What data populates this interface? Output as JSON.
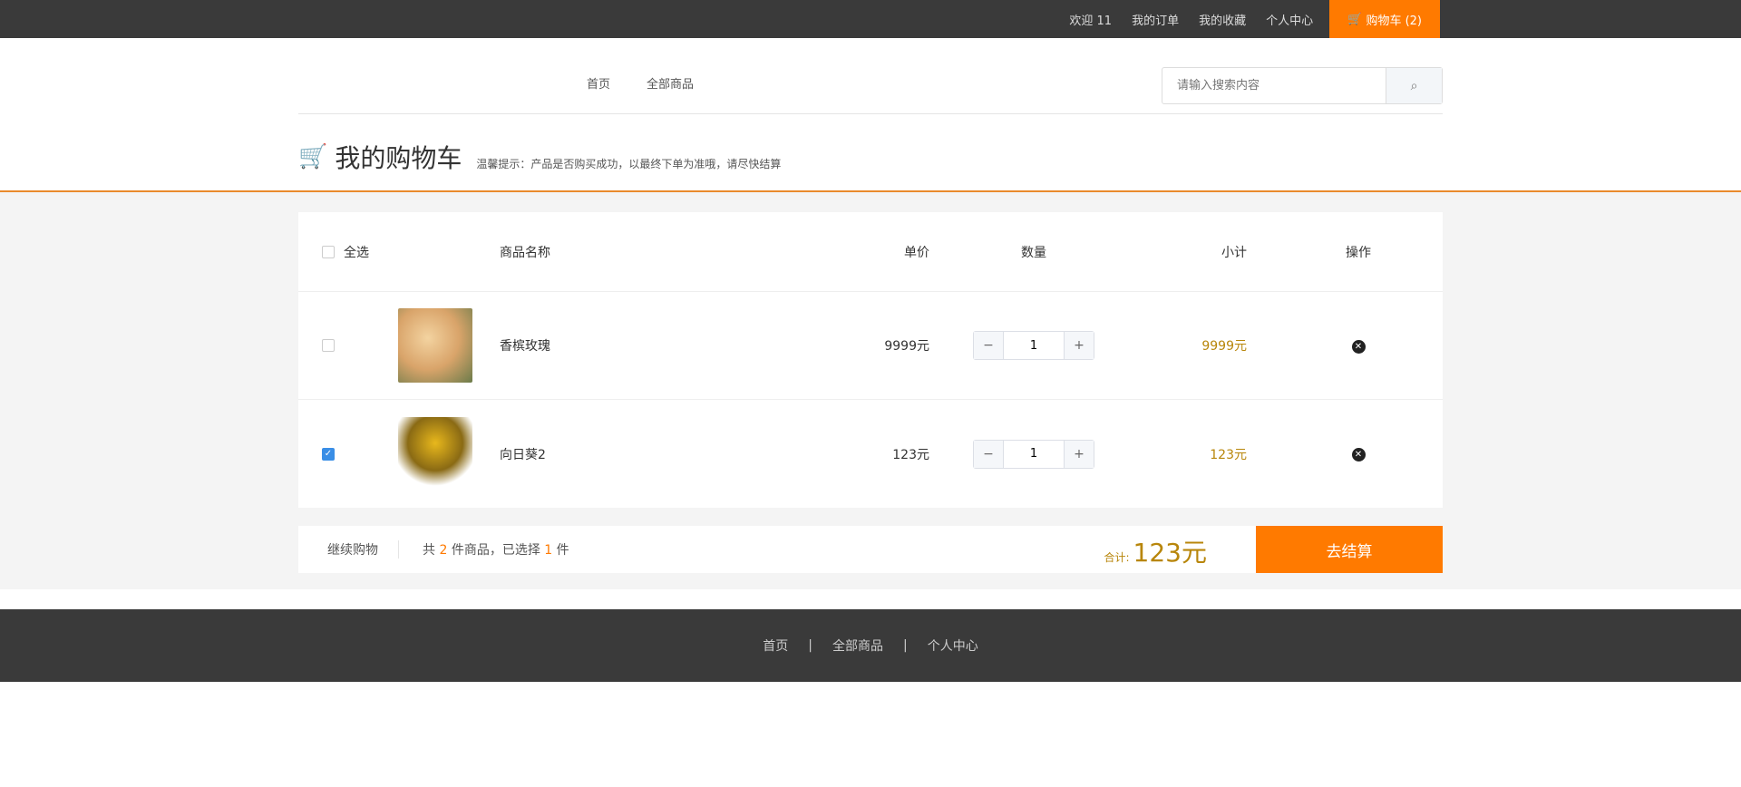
{
  "topbar": {
    "welcome": "欢迎 11",
    "orders": "我的订单",
    "favorites": "我的收藏",
    "profile": "个人中心",
    "cart": "购物车 (2)"
  },
  "nav": {
    "home": "首页",
    "all": "全部商品"
  },
  "search": {
    "placeholder": "请输入搜索内容"
  },
  "page": {
    "title": "我的购物车",
    "tip": "温馨提示：产品是否购买成功，以最终下单为准哦，请尽快结算"
  },
  "table": {
    "headers": {
      "select_all": "全选",
      "name": "商品名称",
      "price": "单价",
      "qty": "数量",
      "subtotal": "小计",
      "action": "操作"
    },
    "items": [
      {
        "name": "香槟玫瑰",
        "price": "9999元",
        "qty": "1",
        "subtotal": "9999元",
        "checked": false
      },
      {
        "name": "向日葵2",
        "price": "123元",
        "qty": "1",
        "subtotal": "123元",
        "checked": true
      }
    ]
  },
  "summary": {
    "continue": "继续购物",
    "count_pre": "共",
    "count": "2",
    "count_mid": "件商品，已选择",
    "selected": "1",
    "count_post": "件",
    "total_label": "合计:",
    "total": "123元",
    "checkout": "去结算"
  },
  "footer": {
    "home": "首页",
    "all": "全部商品",
    "profile": "个人中心",
    "sep": "|"
  },
  "colors": {
    "accent": "#ff7a00",
    "dark": "#3a3a3a"
  }
}
